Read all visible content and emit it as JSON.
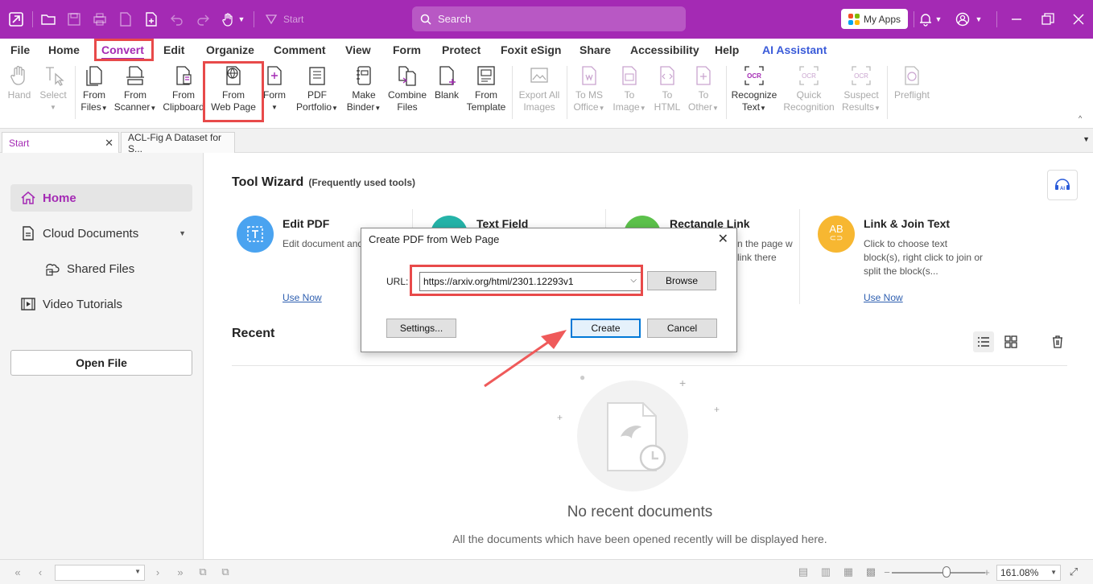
{
  "titlebar": {
    "start_label": "Start",
    "search_placeholder": "Search",
    "myapps_label": "My Apps"
  },
  "menu": {
    "items": [
      "File",
      "Home",
      "Convert",
      "Edit",
      "Organize",
      "Comment",
      "View",
      "Form",
      "Protect",
      "Foxit eSign",
      "Share",
      "Accessibility",
      "Help",
      "AI Assistant"
    ],
    "active": "Convert"
  },
  "ribbon": {
    "hand": "Hand",
    "select": "Select",
    "from_files": [
      "From",
      "Files"
    ],
    "from_scanner": [
      "From",
      "Scanner"
    ],
    "from_clipboard": [
      "From",
      "Clipboard"
    ],
    "from_web_page": [
      "From",
      "Web Page"
    ],
    "form": "Form",
    "pdf_portfolio": [
      "PDF",
      "Portfolio"
    ],
    "make_binder": [
      "Make",
      "Binder"
    ],
    "combine_files": [
      "Combine",
      "Files"
    ],
    "blank": "Blank",
    "from_template": [
      "From",
      "Template"
    ],
    "export_all_images": [
      "Export All",
      "Images"
    ],
    "to_ms_office": [
      "To MS",
      "Office"
    ],
    "to_image": [
      "To",
      "Image"
    ],
    "to_html": [
      "To",
      "HTML"
    ],
    "to_other": [
      "To",
      "Other"
    ],
    "recognize_text": [
      "Recognize",
      "Text"
    ],
    "quick_recognition": [
      "Quick",
      "Recognition"
    ],
    "suspect_results": [
      "Suspect",
      "Results"
    ],
    "preflight": "Preflight"
  },
  "tabs": [
    {
      "label": "Start"
    },
    {
      "label": "ACL-Fig  A Dataset for S..."
    }
  ],
  "sidebar": {
    "items": [
      {
        "label": "Home"
      },
      {
        "label": "Cloud Documents"
      },
      {
        "label": "Shared Files"
      },
      {
        "label": "Video Tutorials"
      }
    ],
    "open_file": "Open File"
  },
  "main": {
    "tool_wizard_title": "Tool Wizard",
    "tool_wizard_sub": "(Frequently used tools)",
    "tools": [
      {
        "title": "Edit PDF",
        "desc": "Edit document and format",
        "link": "Use Now",
        "color": "#4aa3f0"
      },
      {
        "title": "Text Field",
        "desc": "",
        "link": "",
        "color": "#25b3a8"
      },
      {
        "title": "Rectangle Link",
        "desc": "n the page w link there",
        "link": "",
        "color": "#5cc14b"
      },
      {
        "title": "Link & Join Text",
        "desc": "Click to choose text block(s), right click to join or split the block(s...",
        "link": "Use Now",
        "color": "#f7b731",
        "icon": "AB"
      }
    ],
    "recent_title": "Recent",
    "no_recent": "No recent documents",
    "no_recent_sub": "All the documents which have been opened recently will be displayed here."
  },
  "dialog": {
    "title": "Create PDF from Web Page",
    "url_label": "URL:",
    "url_value": "https://arxiv.org/html/2301.12293v1",
    "browse": "Browse",
    "settings": "Settings...",
    "create": "Create",
    "cancel": "Cancel"
  },
  "status": {
    "zoom": "161.08%"
  },
  "colors": {
    "brand": "#a42ab4",
    "highlight": "#e84a4a",
    "link": "#2e5fb0"
  }
}
